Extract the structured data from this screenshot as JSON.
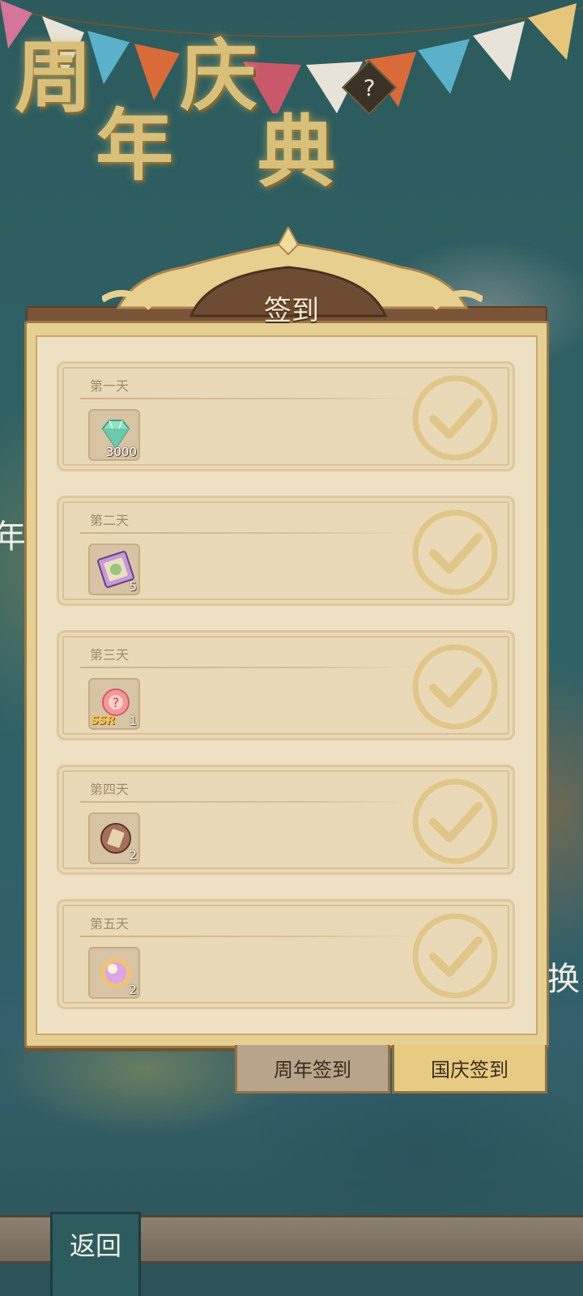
{
  "header": {
    "title_chars": [
      "周",
      "庆",
      "年",
      "典"
    ],
    "help_label": "?"
  },
  "background_text": {
    "left_glyph": "年",
    "right_glyph": "换"
  },
  "panel": {
    "title": "签到",
    "days": [
      {
        "label": "第一天",
        "reward_icon": "diamond-icon",
        "reward_count": "3000",
        "claimed": true
      },
      {
        "label": "第二天",
        "reward_icon": "scroll-icon",
        "reward_count": "5",
        "claimed": true
      },
      {
        "label": "第三天",
        "reward_icon": "ssr-summon-orb-icon",
        "reward_badge": "SSR",
        "reward_count": "1",
        "claimed": true
      },
      {
        "label": "第四天",
        "reward_icon": "ancient-scroll-icon",
        "reward_count": "2",
        "claimed": true
      },
      {
        "label": "第五天",
        "reward_icon": "glowing-orb-icon",
        "reward_count": "2",
        "claimed": true
      }
    ]
  },
  "tabs": [
    {
      "label": "周年签到",
      "active": false
    },
    {
      "label": "国庆签到",
      "active": true
    }
  ],
  "footer": {
    "back_label": "返回"
  },
  "colors": {
    "panel_bg": "#eee0c2",
    "card_bg": "#ead9b6",
    "check_gold": "#e0c688",
    "title_gold": "#d9c07a",
    "tab_active": "#e7cb82",
    "tab_inactive": "#b8a48a"
  }
}
